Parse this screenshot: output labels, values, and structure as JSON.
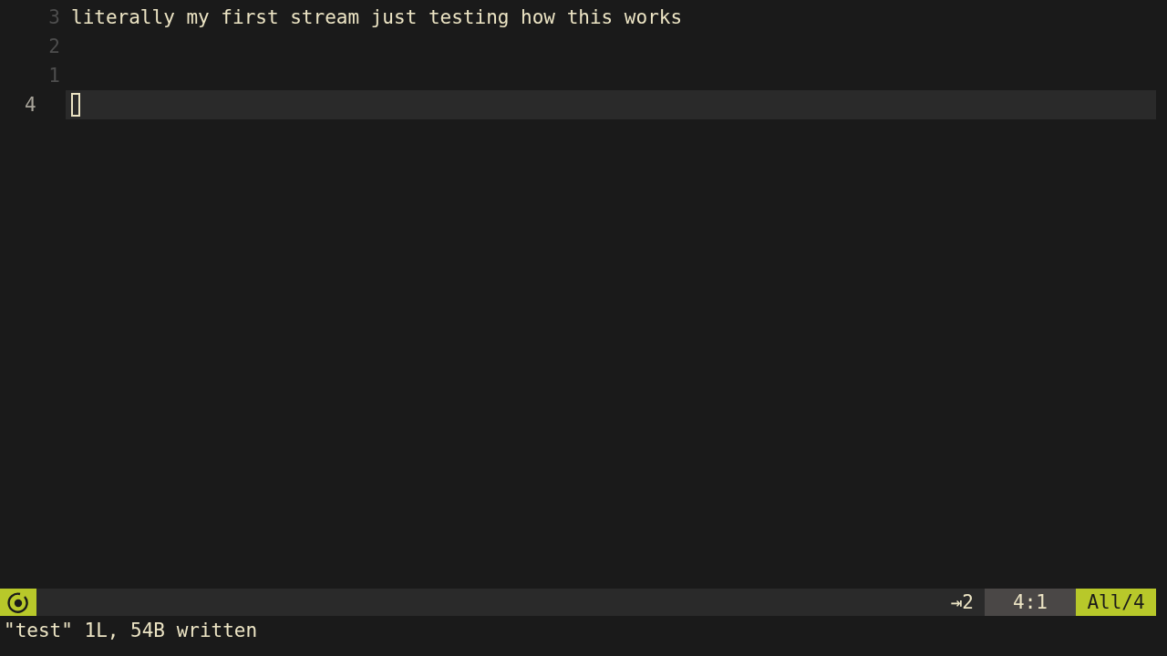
{
  "lines": [
    {
      "number": "3",
      "text": "literally my first stream just testing how this works",
      "current": false
    },
    {
      "number": "2",
      "current": false
    },
    {
      "number": "1",
      "current": false
    },
    {
      "number": "4",
      "current": true
    }
  ],
  "status_bar": {
    "indent": "⇥2",
    "position": "4:1",
    "scroll": "All/4"
  },
  "message": "\"test\" 1L, 54B written"
}
